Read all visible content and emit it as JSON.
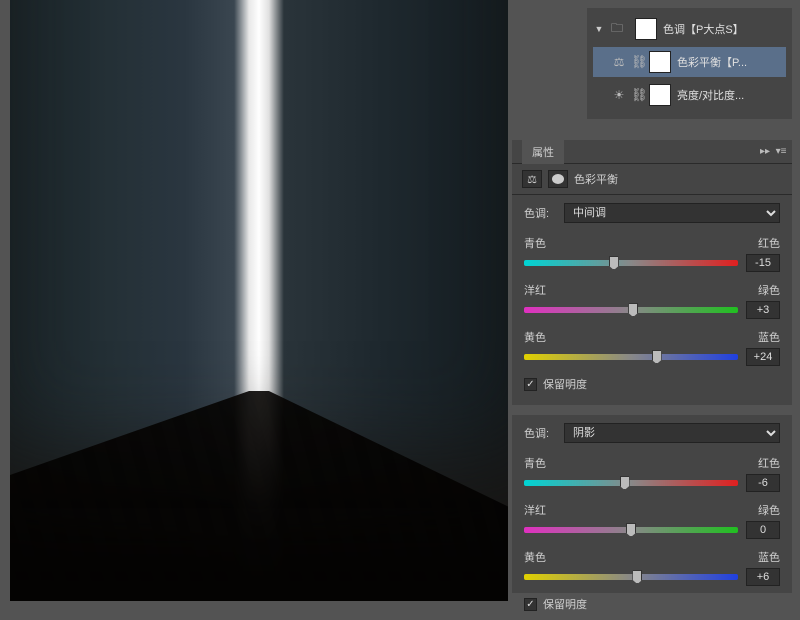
{
  "layers": {
    "group": {
      "name": "色调【P大点S】"
    },
    "item1": {
      "name": "色彩平衡【P..."
    },
    "item2": {
      "name": "亮度/对比度..."
    }
  },
  "panel": {
    "title": "属性",
    "type_label": "色彩平衡",
    "tone_label": "色调:",
    "preserve_lum": "保留明度"
  },
  "midtones": {
    "tone_option": "中间调",
    "cr": {
      "left": "青色",
      "right": "红色",
      "value": "-15",
      "pos": 42
    },
    "mg": {
      "left": "洋红",
      "right": "绿色",
      "value": "+3",
      "pos": 51
    },
    "yb": {
      "left": "黄色",
      "right": "蓝色",
      "value": "+24",
      "pos": 62
    },
    "preserve": true
  },
  "shadows": {
    "tone_option": "阴影",
    "cr": {
      "left": "青色",
      "right": "红色",
      "value": "-6",
      "pos": 47
    },
    "mg": {
      "left": "洋红",
      "right": "绿色",
      "value": "0",
      "pos": 50
    },
    "yb": {
      "left": "黄色",
      "right": "蓝色",
      "value": "+6",
      "pos": 53
    },
    "preserve": true
  },
  "chart_data": {
    "type": "table",
    "title": "Color Balance adjustment values",
    "series": [
      {
        "name": "中间调 (Midtones)",
        "labels": [
          "青色-红色",
          "洋红-绿色",
          "黄色-蓝色"
        ],
        "values": [
          -15,
          3,
          24
        ]
      },
      {
        "name": "阴影 (Shadows)",
        "labels": [
          "青色-红色",
          "洋红-绿色",
          "黄色-蓝色"
        ],
        "values": [
          -6,
          0,
          6
        ]
      }
    ],
    "range": [
      -100,
      100
    ]
  }
}
